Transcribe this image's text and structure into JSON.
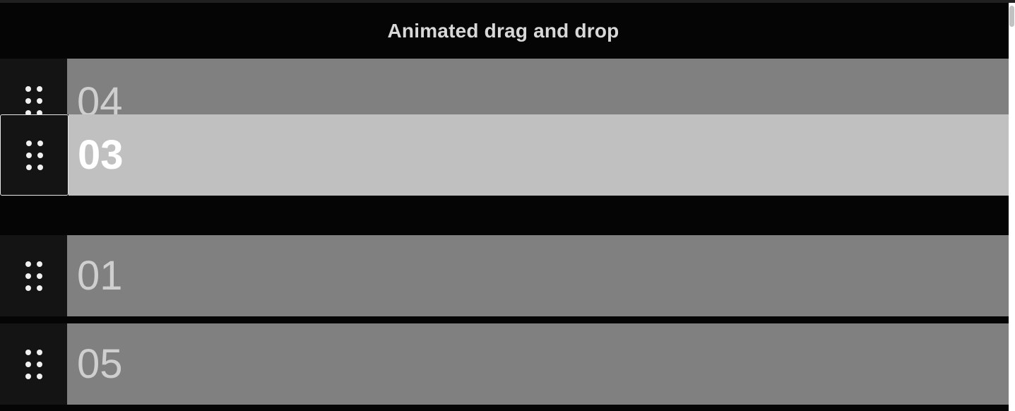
{
  "header": {
    "title": "Animated drag and drop"
  },
  "list": {
    "items": [
      {
        "label": "04",
        "state": "partially-hidden"
      },
      {
        "label": "03",
        "state": "dragging"
      },
      {
        "label": "01",
        "state": "normal"
      },
      {
        "label": "05",
        "state": "normal"
      }
    ]
  },
  "icons": {
    "handle": "drag-handle-icon"
  },
  "colors": {
    "background": "#050505",
    "item": "#808080",
    "item_dragging": "#c0c0c0",
    "handle": "#141414",
    "label": "#cfcfcf",
    "label_dragging": "#ffffff",
    "title": "#d8d8d8"
  }
}
